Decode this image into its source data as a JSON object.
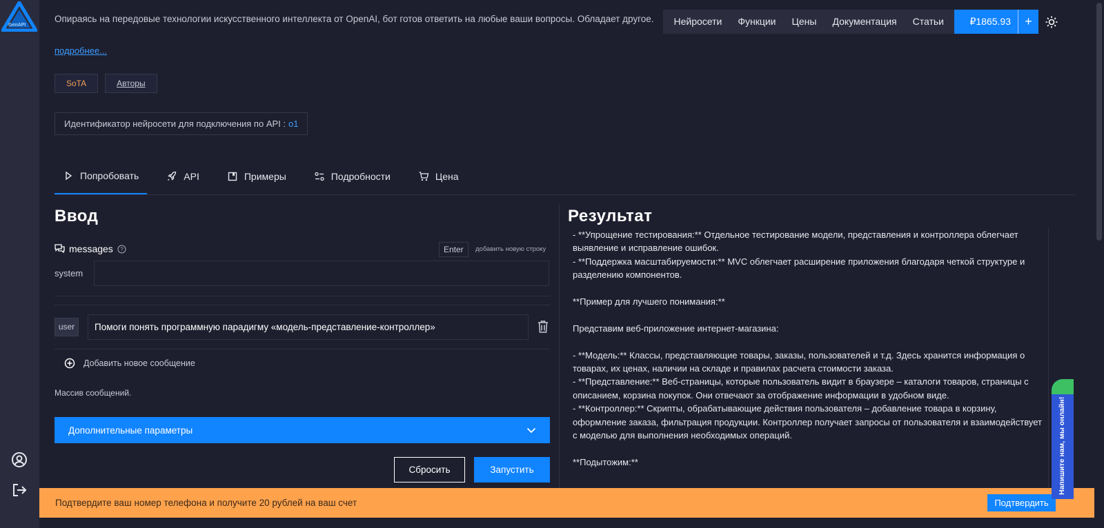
{
  "logo": {
    "text": "GenAPI"
  },
  "intro": {
    "text": "Опираясь на передовые технологии искусственного интеллекта от OpenAI, бот готов ответить на любые ваши вопросы. Обладает другое.",
    "more_link": "подробнее..."
  },
  "tags": [
    {
      "label": "SoTA"
    },
    {
      "label": "Авторы"
    }
  ],
  "api_id": {
    "label": "Идентификатор нейросети для подключения по API :",
    "value": "o1"
  },
  "nav": {
    "links": [
      "Нейросети",
      "Функции",
      "Цены",
      "Документация",
      "Статьи"
    ],
    "balance": "₽1865.93",
    "plus": "+"
  },
  "tabs": [
    {
      "label": "Попробовать",
      "icon": "play-icon"
    },
    {
      "label": "API",
      "icon": "rocket-icon"
    },
    {
      "label": "Примеры",
      "icon": "bookmark-icon"
    },
    {
      "label": "Подробности",
      "icon": "settings-icon"
    },
    {
      "label": "Цена",
      "icon": "cart-icon"
    }
  ],
  "input": {
    "title": "Ввод",
    "messages_label": "messages",
    "enter_key": "Enter",
    "enter_hint": "добавить новую строку",
    "system_label": "system",
    "system_value": "",
    "user_label": "user",
    "user_value": "Помоги понять программную парадигму «модель-представление-контроллер»",
    "add_message": "Добавить новое сообщение",
    "array_note": "Массив сообщений.",
    "extra_params": "Дополнительные параметры",
    "reset": "Сбросить",
    "run": "Запустить"
  },
  "result": {
    "title": "Результат",
    "text": "- **Упрощение тестирования:** Отдельное тестирование модели, представления и контроллера облегчает выявление и исправление ошибок.\n- **Поддержка масштабируемости:** MVC облегчает расширение приложения благодаря четкой структуре и разделению компонентов.\n\n**Пример для лучшего понимания:**\n\nПредставим веб-приложение интернет-магазина:\n\n- **Модель:** Классы, представляющие товары, заказы, пользователей и т.д. Здесь хранится информация о товарах, их ценах, наличии на складе и правилах расчета стоимости заказа.\n- **Представление:** Веб-страницы, которые пользователь видит в браузере – каталоги товаров, страницы с описанием, корзина покупок. Они отвечают за отображение информации в удобном виде.\n- **Контроллер:** Скрипты, обрабатывающие действия пользователя – добавление товара в корзину, оформление заказа, фильтрация продукции. Контроллер получает запросы от пользователя и взаимодействует с моделью для выполнения необходимых операций.\n\n**Подытожим:**"
  },
  "banner": {
    "text": "Подтвердите ваш номер телефона и получите 20 рублей на ваш счет",
    "button": "Подтвердить"
  },
  "chat_widget": {
    "text": "Напишите нам, мы онлайн!"
  },
  "colors": {
    "accent": "#1184ff",
    "banner": "#ffa24c",
    "background": "#1e1f2e",
    "sota": "#f2a15a"
  }
}
